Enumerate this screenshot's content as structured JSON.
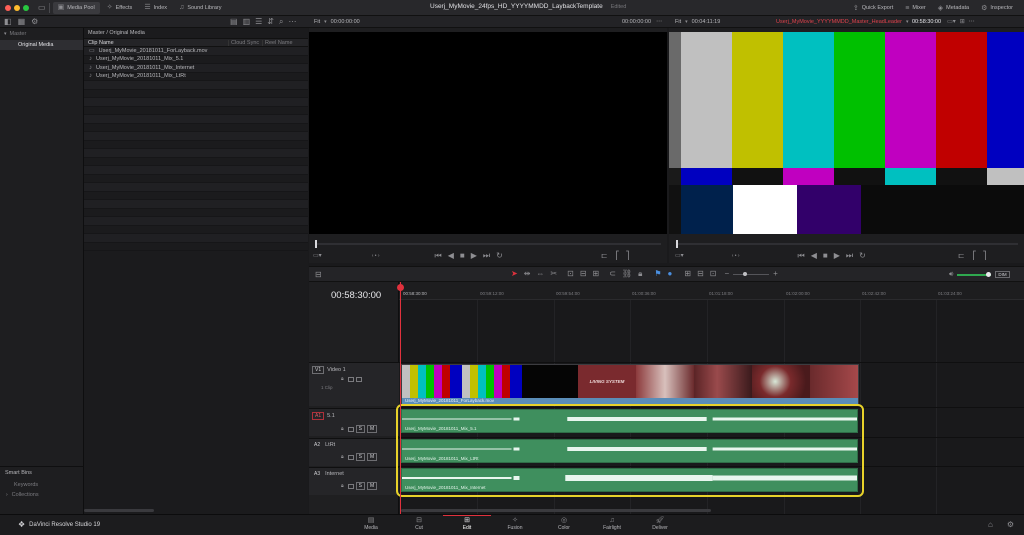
{
  "topbar": {
    "tabs": [
      {
        "label": "Media Pool",
        "icon": "media-pool-icon"
      },
      {
        "label": "Effects",
        "icon": "effects-icon"
      },
      {
        "label": "Index",
        "icon": "index-icon"
      },
      {
        "label": "Sound Library",
        "icon": "sound-library-icon"
      }
    ],
    "project_title": "Userj_MyMovie_24fps_HD_YYYYMMDD_LaybackTemplate",
    "project_status": "Edited",
    "right_tabs": [
      {
        "label": "Quick Export",
        "icon": "export-icon"
      },
      {
        "label": "Mixer",
        "icon": "mixer-icon"
      },
      {
        "label": "Metadata",
        "icon": "metadata-icon"
      },
      {
        "label": "Inspector",
        "icon": "inspector-icon"
      }
    ]
  },
  "source_viewer": {
    "zoom": "Fit",
    "timecode_left": "00:00:00:00",
    "timecode_right": "00:00:00:00"
  },
  "program_viewer": {
    "zoom": "Fit",
    "duration": "00:04:11:19",
    "timeline_name": "Userj_MyMovie_YYYYMMDD_Master_HeadLeader",
    "timecode": "00:58:30:00"
  },
  "bins": {
    "master_label": "Master",
    "selected_bin": "Original Media",
    "smart_bins_label": "Smart Bins",
    "smart_items": [
      "Keywords",
      "Collections"
    ]
  },
  "media_pool": {
    "breadcrumb": "Master / Original Media",
    "columns": [
      "Clip Name",
      "Cloud Sync",
      "Reel Name"
    ],
    "clips": [
      {
        "name": "Userj_MyMovie_20181011_ForLayback.mov",
        "icon": "video-clip-icon"
      },
      {
        "name": "Userj_MyMovie_20181011_Mix_5.1",
        "icon": "audio-clip-icon"
      },
      {
        "name": "Userj_MyMovie_20181011_Mix_Internet",
        "icon": "audio-clip-icon"
      },
      {
        "name": "Userj_MyMovie_20181011_Mix_LtRt",
        "icon": "audio-clip-icon"
      }
    ]
  },
  "timeline": {
    "timecode": "00:58:30:00",
    "ruler": [
      "00:58:30:00",
      "00:59:12:00",
      "00:59:54:00",
      "01:00:36:00",
      "01:01:18:00",
      "01:02:00:00",
      "01:02:42:00",
      "01:03:24:00"
    ],
    "video_tracks": [
      {
        "tag": "V1",
        "name": "Video 1",
        "clip_count": "1 Clip",
        "clip_name": "Userj_MyMovie_20181011_ForLayback.mov"
      }
    ],
    "audio_tracks": [
      {
        "tag": "A1",
        "name": "5.1",
        "clip_name": "Userj_MyMovie_20181011_Mix_5.1"
      },
      {
        "tag": "A2",
        "name": "LtRt",
        "clip_name": "Userj_MyMovie_20181011_Mix_LtRt"
      },
      {
        "tag": "A3",
        "name": "Internet",
        "clip_name": "Userj_MyMovie_20181011_Mix_Internet"
      }
    ],
    "frame_title": "LIVING SYSTEM",
    "level_button": "DIM"
  },
  "bottom": {
    "app_name": "DaVinci Resolve Studio 19",
    "pages": [
      {
        "label": "Media",
        "icon": "media-page-icon"
      },
      {
        "label": "Cut",
        "icon": "cut-page-icon"
      },
      {
        "label": "Edit",
        "icon": "edit-page-icon"
      },
      {
        "label": "Fusion",
        "icon": "fusion-page-icon"
      },
      {
        "label": "Color",
        "icon": "color-page-icon"
      },
      {
        "label": "Fairlight",
        "icon": "fairlight-page-icon"
      },
      {
        "label": "Deliver",
        "icon": "deliver-page-icon"
      }
    ],
    "active_page": "Edit"
  },
  "colors": {
    "accent_red": "#e0313d",
    "audio_clip": "#3f8f5e",
    "video_clip_bar": "#5a8db8",
    "selection_outline": "#e8d22a"
  }
}
